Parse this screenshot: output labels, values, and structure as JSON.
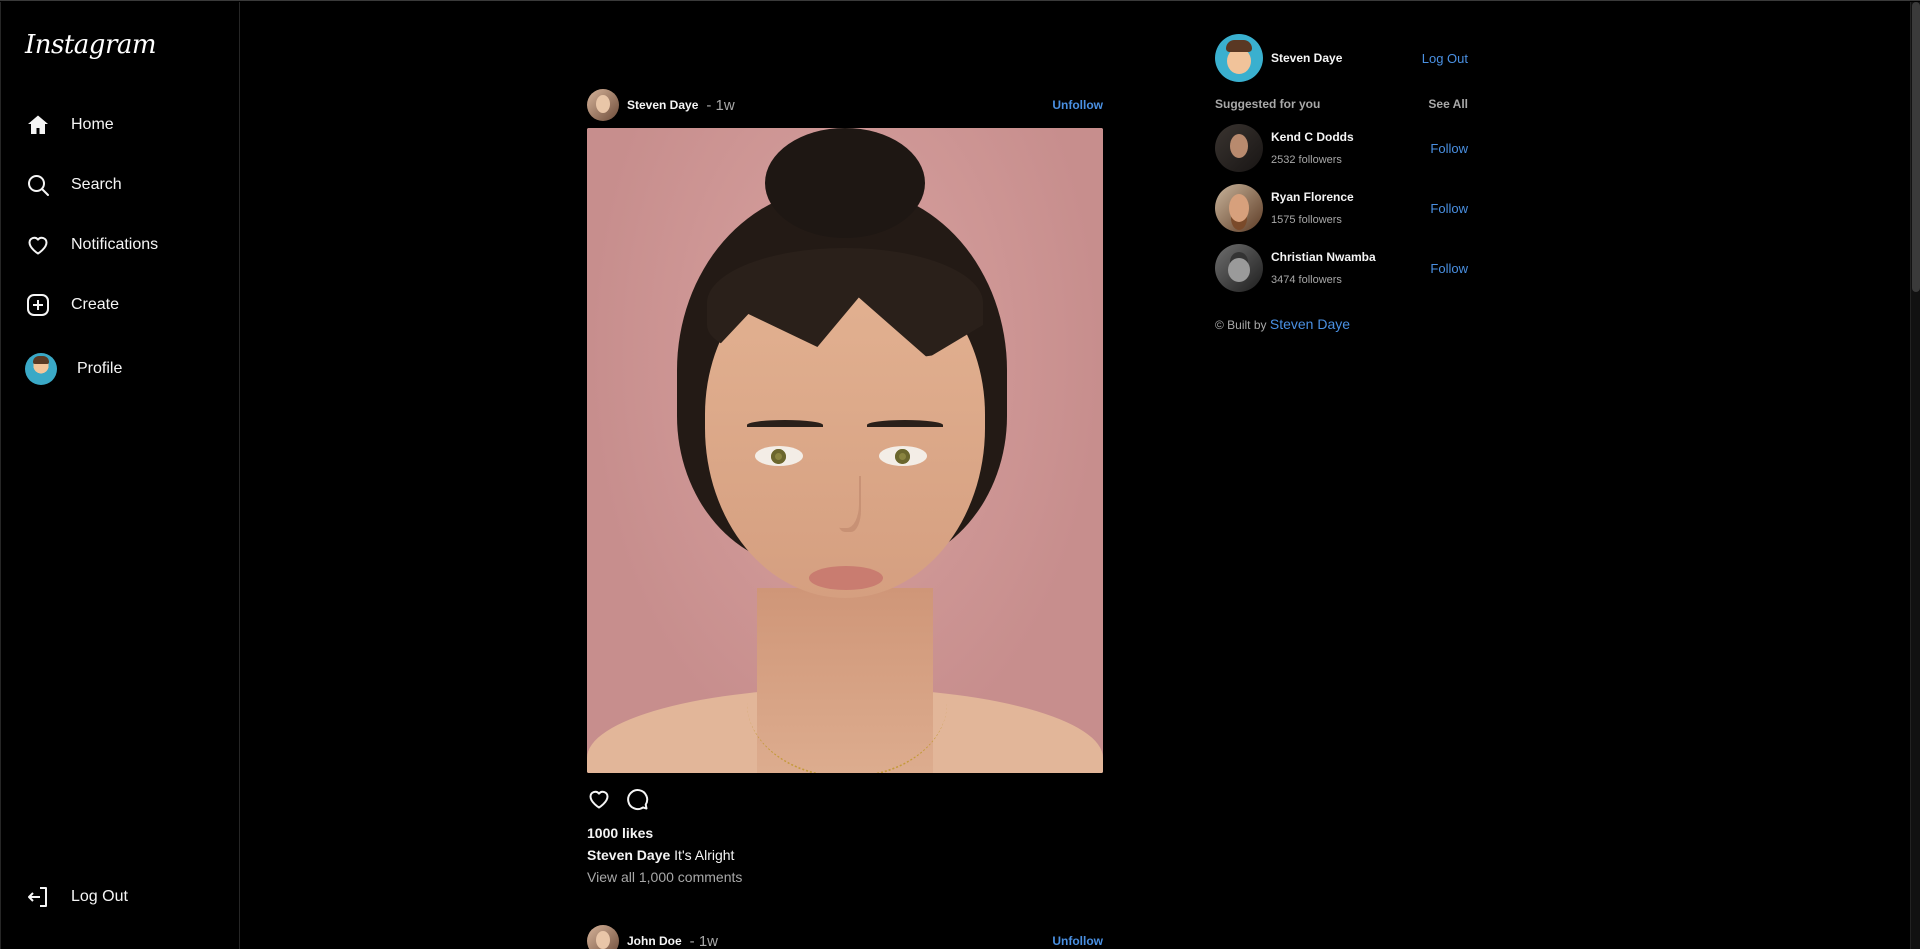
{
  "app": {
    "logo": "Instagram"
  },
  "sidebar": {
    "items": [
      {
        "label": "Home",
        "icon": "home-icon"
      },
      {
        "label": "Search",
        "icon": "search-icon"
      },
      {
        "label": "Notifications",
        "icon": "heart-icon"
      },
      {
        "label": "Create",
        "icon": "plus-square-icon"
      },
      {
        "label": "Profile",
        "icon": "avatar"
      }
    ],
    "logout": {
      "label": "Log Out",
      "icon": "logout-icon"
    }
  },
  "feed": {
    "posts": [
      {
        "user": "Steven Daye",
        "time": "- 1w",
        "action": "Unfollow",
        "likes": "1000 likes",
        "caption_user": "Steven Daye",
        "caption_text": "It's Alright",
        "comments": "View all 1,000 comments"
      },
      {
        "user": "John Doe",
        "time": "- 1w",
        "action": "Unfollow"
      }
    ]
  },
  "right": {
    "me": {
      "name": "Steven Daye",
      "logout": "Log Out"
    },
    "suggest_title": "Suggested for you",
    "see_all": "See All",
    "suggestions": [
      {
        "name": "Kend C Dodds",
        "sub": "2532 followers",
        "action": "Follow"
      },
      {
        "name": "Ryan Florence",
        "sub": "1575 followers",
        "action": "Follow"
      },
      {
        "name": "Christian Nwamba",
        "sub": "3474 followers",
        "action": "Follow"
      }
    ],
    "credit_prefix": "© Built by",
    "credit_name": "Steven Daye"
  },
  "colors": {
    "background": "#000000",
    "accent": "#4a90e2",
    "muted": "#a8a8a8"
  }
}
